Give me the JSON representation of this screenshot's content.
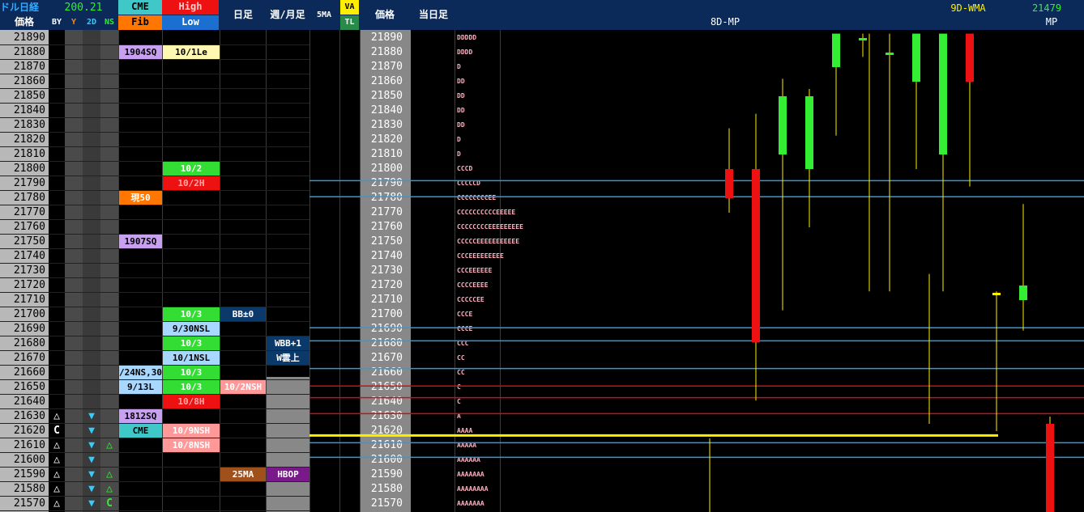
{
  "header": {
    "title": "ドル日経",
    "price_label": "価格",
    "top_value": "200.21",
    "sub_cols": [
      "BY",
      "Y",
      "2D",
      "NS"
    ],
    "cme": "CME",
    "fib": "Fib",
    "high": "High",
    "low": "Low",
    "daily": "日足",
    "weekly_monthly": "週/月足",
    "ma5": "5MA",
    "va": "VA",
    "tl": "TL",
    "price2": "価格",
    "today": "当日足",
    "mp8d": "8D-MP",
    "wma9d": "9D-WMA",
    "mp_value": "21479",
    "mp_label": "MP"
  },
  "prices": [
    "21890",
    "21880",
    "21870",
    "21860",
    "21850",
    "21840",
    "21830",
    "21820",
    "21810",
    "21800",
    "21790",
    "21780",
    "21770",
    "21760",
    "21750",
    "21740",
    "21730",
    "21720",
    "21710",
    "21700",
    "21690",
    "21680",
    "21670",
    "21660",
    "21650",
    "21640",
    "21630",
    "21620",
    "21610",
    "21600",
    "21590",
    "21580",
    "21570"
  ],
  "left_marks": {
    "by": {
      "27": "△",
      "28": "C",
      "29": "△",
      "30": "△",
      "31": "△",
      "32": "△",
      "33": "△"
    },
    "d2": {
      "27": "▼",
      "28": "▼",
      "29": "▼",
      "30": "▼",
      "31": "▼",
      "32": "▼",
      "33": "▼"
    },
    "ns": {
      "29": "△",
      "31": "△",
      "32": "△",
      "33": "C"
    }
  },
  "labels": [
    {
      "col": "cme",
      "row": 2,
      "text": "1904SQ",
      "bg": "#c8a0f0",
      "fg": "#000"
    },
    {
      "col": "hl",
      "row": 2,
      "text": "10/1Le",
      "bg": "#fff8b0",
      "fg": "#000"
    },
    {
      "col": "hl",
      "row": 10,
      "text": "10/2",
      "bg": "#33dd33",
      "fg": "#fff"
    },
    {
      "col": "hl",
      "row": 11,
      "text": "10/2H",
      "bg": "#ee1111",
      "fg": "#ffaaaa"
    },
    {
      "col": "cme",
      "row": 12,
      "text": "現50",
      "bg": "#ff7700",
      "fg": "#fff"
    },
    {
      "col": "cme",
      "row": 15,
      "text": "1907SQ",
      "bg": "#c8a0f0",
      "fg": "#000"
    },
    {
      "col": "hl",
      "row": 20,
      "text": "10/3",
      "bg": "#33dd33",
      "fg": "#fff"
    },
    {
      "col": "daily",
      "row": 20,
      "text": "BB±0",
      "bg": "#0b3a6a",
      "fg": "#fff"
    },
    {
      "col": "hl",
      "row": 21,
      "text": "9/30NSL",
      "bg": "#a8d8ff",
      "fg": "#000"
    },
    {
      "col": "hl",
      "row": 22,
      "text": "10/3",
      "bg": "#33dd33",
      "fg": "#fff"
    },
    {
      "col": "week",
      "row": 22,
      "text": "WBB+1",
      "bg": "#0b3a6a",
      "fg": "#fff"
    },
    {
      "col": "hl",
      "row": 23,
      "text": "10/1NSL",
      "bg": "#a8d8ff",
      "fg": "#000"
    },
    {
      "col": "week",
      "row": 23,
      "text": "W雲上",
      "bg": "#0b3a6a",
      "fg": "#fff"
    },
    {
      "col": "cme",
      "row": 24,
      "text": "/24NS,30",
      "bg": "#a8d8ff",
      "fg": "#000"
    },
    {
      "col": "hl",
      "row": 24,
      "text": "10/3",
      "bg": "#33dd33",
      "fg": "#fff"
    },
    {
      "col": "cme",
      "row": 25,
      "text": "9/13L",
      "bg": "#a8d8ff",
      "fg": "#000"
    },
    {
      "col": "hl",
      "row": 25,
      "text": "10/3",
      "bg": "#33dd33",
      "fg": "#fff"
    },
    {
      "col": "daily",
      "row": 25,
      "text": "10/2NSH",
      "bg": "#ff9999",
      "fg": "#fff"
    },
    {
      "col": "hl",
      "row": 26,
      "text": "10/8H",
      "bg": "#ee1111",
      "fg": "#ffaaaa"
    },
    {
      "col": "cme",
      "row": 27,
      "text": "1812SQ",
      "bg": "#c8a0f0",
      "fg": "#000"
    },
    {
      "col": "cme",
      "row": 28,
      "text": "CME",
      "bg": "#40c8c8",
      "fg": "#000"
    },
    {
      "col": "hl",
      "row": 28,
      "text": "10/9NSH",
      "bg": "#ff9999",
      "fg": "#fff"
    },
    {
      "col": "hl",
      "row": 29,
      "text": "10/8NSH",
      "bg": "#ff9999",
      "fg": "#fff"
    },
    {
      "col": "daily",
      "row": 31,
      "text": "25MA",
      "bg": "#a0501a",
      "fg": "#fff"
    },
    {
      "col": "week",
      "row": 31,
      "text": "HBOP",
      "bg": "#7a1a8a",
      "fg": "#fff"
    }
  ],
  "tpo": [
    "DDDDD",
    "DDDD",
    "D",
    "DD",
    "DD",
    "DD",
    "DD",
    "D",
    "D",
    "CCCD",
    "CCCCCD",
    "CCCCCCCCEE",
    "CCCCCCCCCCEEEEE",
    "CCCCCCCCEEEEEEEEE",
    "CCCCCEEEEEEEEEEE",
    "CCCEEEEEEEEE",
    "CCCEEEEEE",
    "CCCCEEEE",
    "CCCCCEE",
    "CCCE",
    "CCCE",
    "CCC",
    "CC",
    "CC",
    "C",
    "C",
    "A",
    "AAAA",
    "AAAAA",
    "AAAAAA",
    "AAAAAAA",
    "AAAAAAAA",
    "AAAAAAA"
  ],
  "lines": [
    {
      "price": 21792,
      "color": "#3399dd"
    },
    {
      "price": 21781,
      "color": "#3399dd"
    },
    {
      "price": 21691,
      "color": "#3399dd"
    },
    {
      "price": 21682,
      "color": "#3399dd"
    },
    {
      "price": 21663,
      "color": "#3399dd"
    },
    {
      "price": 21651,
      "color": "#cc1111"
    },
    {
      "price": 21643,
      "color": "#cc1111"
    },
    {
      "price": 21632,
      "color": "#cc1111"
    },
    {
      "price": 21617,
      "color": "#ffee00"
    },
    {
      "price": 21612,
      "color": "#3399dd"
    },
    {
      "price": 21602,
      "color": "#3399dd"
    }
  ],
  "candles": [
    {
      "open": 21800,
      "high": 21828,
      "low": 21770,
      "close": 21780,
      "color": "#ee1111"
    },
    {
      "open": 21800,
      "high": 21838,
      "low": 21641,
      "close": 21681,
      "color": "#ee1111"
    },
    {
      "open": 21810,
      "high": 21862,
      "low": 21703,
      "close": 21850,
      "color": "#33ee33"
    },
    {
      "open": 21800,
      "high": 21855,
      "low": 21760,
      "close": 21850,
      "color": "#33ee33"
    },
    {
      "open": 21870,
      "high": 21890,
      "low": 21823,
      "close": 21893,
      "color": "#33ee33"
    },
    {
      "open": 21890,
      "high": 21893,
      "low": 21877,
      "close": 21890,
      "color": "#33ee33"
    },
    {
      "open": 21880,
      "high": 21893,
      "low": 21716,
      "close": 21880,
      "color": "#33ee33"
    },
    {
      "open": 21860,
      "high": 21893,
      "low": 21800,
      "close": 21893,
      "color": "#33ee33"
    },
    {
      "open": 21810,
      "high": 21893,
      "low": 21716,
      "close": 21893,
      "color": "#33ee33"
    },
    {
      "open": 21860,
      "high": 21893,
      "low": 21788,
      "close": 21893,
      "color": "#ee1111"
    },
    {
      "open": 21715,
      "high": 21716,
      "low": 21620,
      "close": 21715,
      "color": "#ffee00"
    },
    {
      "open": 21710,
      "high": 21776,
      "low": 21689,
      "close": 21720,
      "color": "#33ee33"
    },
    {
      "open": 21625,
      "high": 21630,
      "low": 21560,
      "close": 21560,
      "color": "#ee1111"
    }
  ]
}
